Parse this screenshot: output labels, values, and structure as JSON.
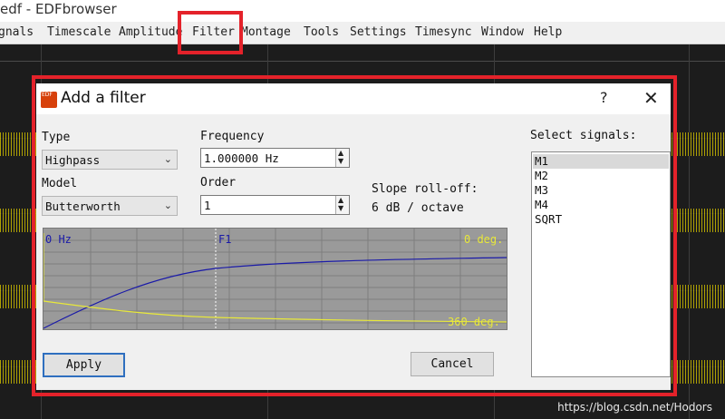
{
  "window": {
    "title": "a.edf - EDFbrowser"
  },
  "menu": [
    "gnals",
    "Timescale",
    "Amplitude",
    "Filter",
    "Montage",
    "Tools",
    "Settings",
    "Timesync",
    "Window",
    "Help"
  ],
  "dialog": {
    "title": "Add a filter",
    "help": "?",
    "close": "✕",
    "type_label": "Type",
    "type_value": "Highpass",
    "model_label": "Model",
    "model_value": "Butterworth",
    "frequency_label": "Frequency",
    "frequency_value": "1.000000 Hz",
    "order_label": "Order",
    "order_value": "1",
    "slope_label": "Slope roll-off:",
    "slope_value": "6 dB / octave",
    "graph": {
      "left_label": "0 Hz",
      "center_label": "F1",
      "top_right_label": "0 deg.",
      "bottom_right_label": "360 deg."
    },
    "apply_label": "Apply",
    "cancel_label": "Cancel",
    "signals_label": "Select signals:",
    "signals": [
      "M1",
      "M2",
      "M3",
      "M4",
      "SQRT"
    ],
    "selected_signal": "M1"
  },
  "watermark": "https://blog.csdn.net/Hodors",
  "colors": {
    "highlight": "#e4222a",
    "magnitude_curve": "#1a1aa8",
    "phase_curve": "#e8e83a",
    "graph_bg": "#9a9a9a"
  }
}
